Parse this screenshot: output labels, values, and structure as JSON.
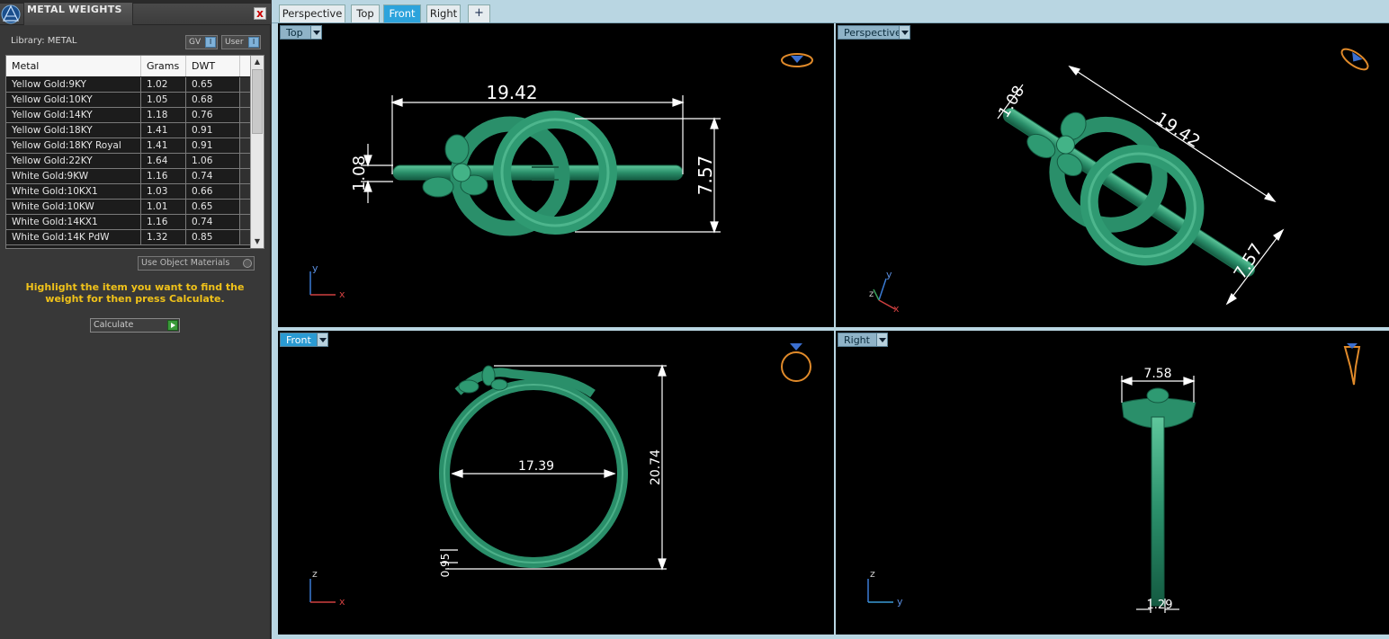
{
  "panel": {
    "title": "METAL WEIGHTS",
    "close": "x",
    "library": "Library: METAL",
    "toggle_gv": "GV",
    "toggle_user": "User",
    "toggle_indicator": "I",
    "table": {
      "headers": [
        "Metal",
        "Grams",
        "DWT"
      ],
      "rows": [
        [
          "Yellow Gold:9KY",
          "1.02",
          "0.65"
        ],
        [
          "Yellow Gold:10KY",
          "1.05",
          "0.68"
        ],
        [
          "Yellow Gold:14KY",
          "1.18",
          "0.76"
        ],
        [
          "Yellow Gold:18KY",
          "1.41",
          "0.91"
        ],
        [
          "Yellow Gold:18KY Royal",
          "1.41",
          "0.91"
        ],
        [
          "Yellow Gold:22KY",
          "1.64",
          "1.06"
        ],
        [
          "White Gold:9KW",
          "1.16",
          "0.74"
        ],
        [
          "White Gold:10KX1",
          "1.03",
          "0.66"
        ],
        [
          "White Gold:10KW",
          "1.01",
          "0.65"
        ],
        [
          "White Gold:14KX1",
          "1.16",
          "0.74"
        ],
        [
          "White Gold:14K PdW",
          "1.32",
          "0.85"
        ]
      ]
    },
    "use_object_materials": "Use Object Materials",
    "hint": "Highlight the item you want to find the weight for then press Calculate.",
    "calculate": "Calculate"
  },
  "tabs": [
    {
      "label": "Perspective",
      "active": false
    },
    {
      "label": "Top",
      "active": false
    },
    {
      "label": "Front",
      "active": true
    },
    {
      "label": "Right",
      "active": false
    },
    {
      "label": "+",
      "active": false
    }
  ],
  "viewports": {
    "top": {
      "label": "Top",
      "dims": {
        "width": "19.42",
        "thickness": "1.08",
        "height": "7.57"
      },
      "axes": {
        "up": "y",
        "right": "x"
      }
    },
    "perspective": {
      "label": "Perspective",
      "dims": {
        "width": "19.42",
        "thickness": "1.08",
        "height": "7.57"
      },
      "axes": {
        "up": "y",
        "right": "x",
        "depth": "z"
      }
    },
    "front": {
      "label": "Front",
      "dims": {
        "inner": "17.39",
        "outer": "20.74",
        "band": "0.95"
      },
      "axes": {
        "up": "z",
        "right": "x"
      }
    },
    "right": {
      "label": "Right",
      "dims": {
        "top": "7.58",
        "bottom": "1.29"
      },
      "axes": {
        "up": "z",
        "right": "y"
      }
    }
  },
  "colors": {
    "model_green": "#2a8f6a",
    "accent_blue": "#2ca3dc",
    "hint_yellow": "#f0c21a",
    "viewport_bg": "#000000"
  }
}
